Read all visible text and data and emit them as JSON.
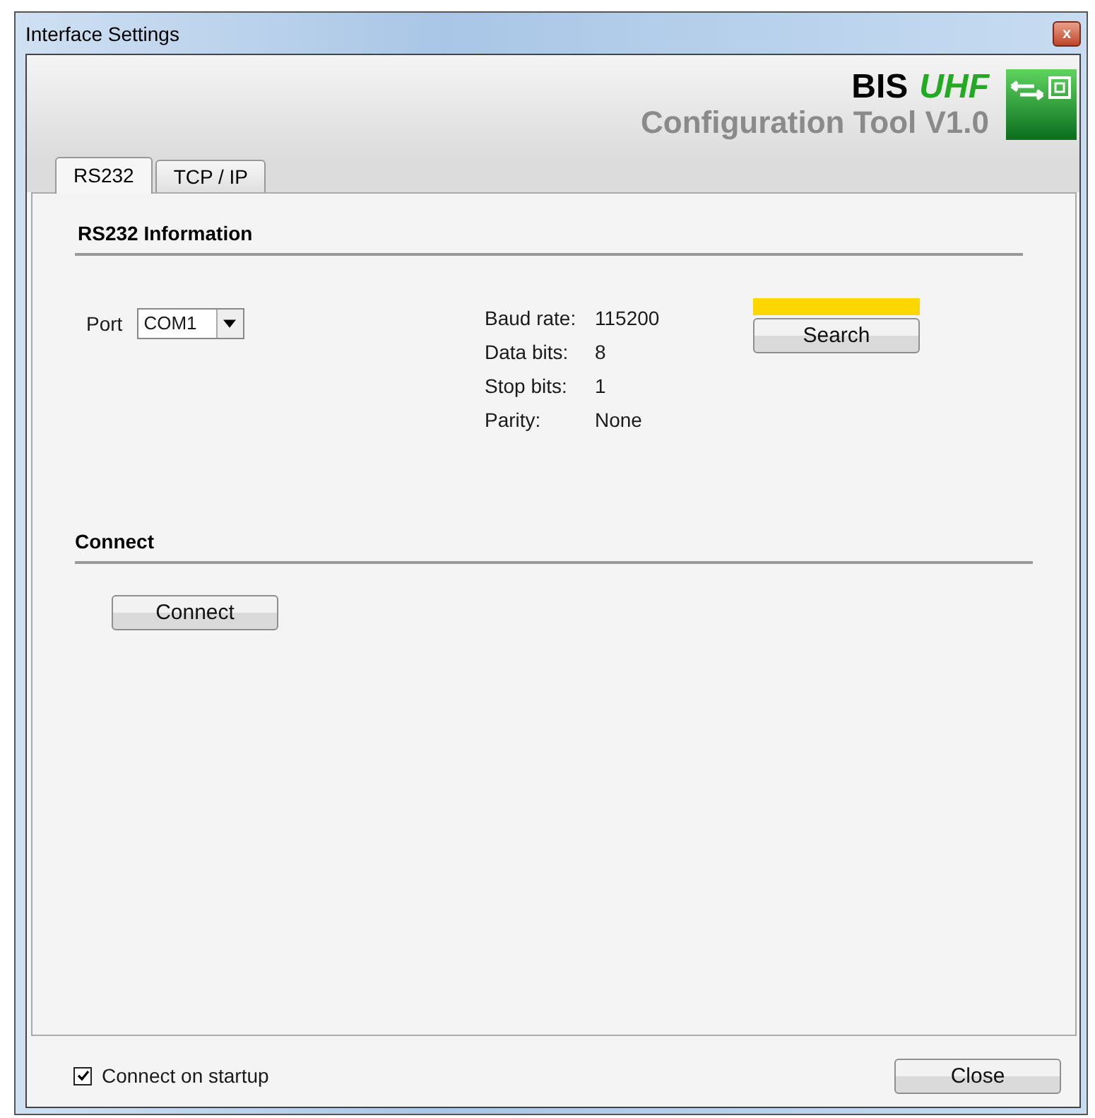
{
  "window": {
    "title": "Interface Settings",
    "close_label": "x"
  },
  "header": {
    "brand": "BIS",
    "product": "UHF",
    "subtitle": "Configuration Tool V1.0"
  },
  "tabs": [
    {
      "label": "RS232",
      "selected": true
    },
    {
      "label": "TCP / IP",
      "selected": false
    }
  ],
  "rs232": {
    "heading": "RS232 Information",
    "port": {
      "label": "Port",
      "value": "COM1"
    },
    "info": [
      {
        "label": "Baud rate:",
        "value": "115200"
      },
      {
        "label": "Data bits:",
        "value": "8"
      },
      {
        "label": "Stop bits:",
        "value": "1"
      },
      {
        "label": "Parity:",
        "value": "None"
      }
    ],
    "search_progress": {
      "level": 1
    },
    "search_button": "Search"
  },
  "connect": {
    "heading": "Connect",
    "button": "Connect"
  },
  "footer": {
    "startup": {
      "label": "Connect on startup",
      "checked": true
    },
    "close_button": "Close"
  }
}
